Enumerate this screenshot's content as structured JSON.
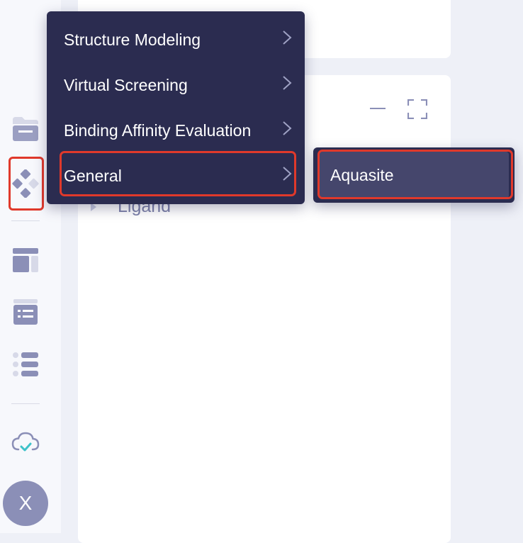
{
  "sidebar": {
    "avatar_letter": "X",
    "icons": [
      "folder-icon",
      "apps-icon",
      "layout-icon",
      "form-list-icon",
      "list-icon",
      "cloud-check-icon"
    ],
    "active_color": "#8b8fb7",
    "highlight_color": "#e0392b"
  },
  "tree": {
    "items": [
      {
        "label": "Ligand"
      }
    ]
  },
  "menu": {
    "items": [
      {
        "label": "Structure Modeling"
      },
      {
        "label": "Virtual Screening"
      },
      {
        "label": "Binding Affinity Evaluation"
      },
      {
        "label": "General"
      }
    ],
    "background": "#2b2c50"
  },
  "submenu": {
    "items": [
      {
        "label": "Aquasite"
      }
    ]
  }
}
